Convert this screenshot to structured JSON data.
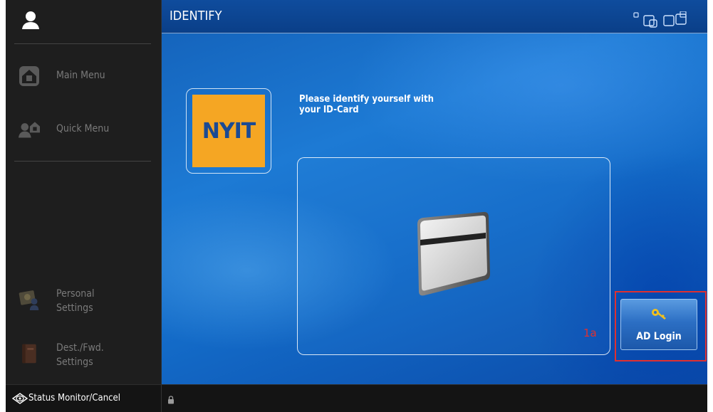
{
  "sidebar": {
    "items": [
      {
        "label": "Main Menu"
      },
      {
        "label": "Quick Menu"
      },
      {
        "label": "Personal\nSettings"
      },
      {
        "label": "Dest./Fwd.\nSettings"
      }
    ]
  },
  "header": {
    "title": "IDENTIFY"
  },
  "main": {
    "logo_text": "NYIT",
    "instruction": "Please identify yourself with\nyour ID-Card",
    "ad_login_label": "AD Login",
    "annotation": "1a"
  },
  "statusbar": {
    "status_label": "Status Monitor/Cancel"
  },
  "colors": {
    "accent": "#1d7ad4",
    "logo_bg": "#f5a623",
    "annotation": "#e03030"
  }
}
